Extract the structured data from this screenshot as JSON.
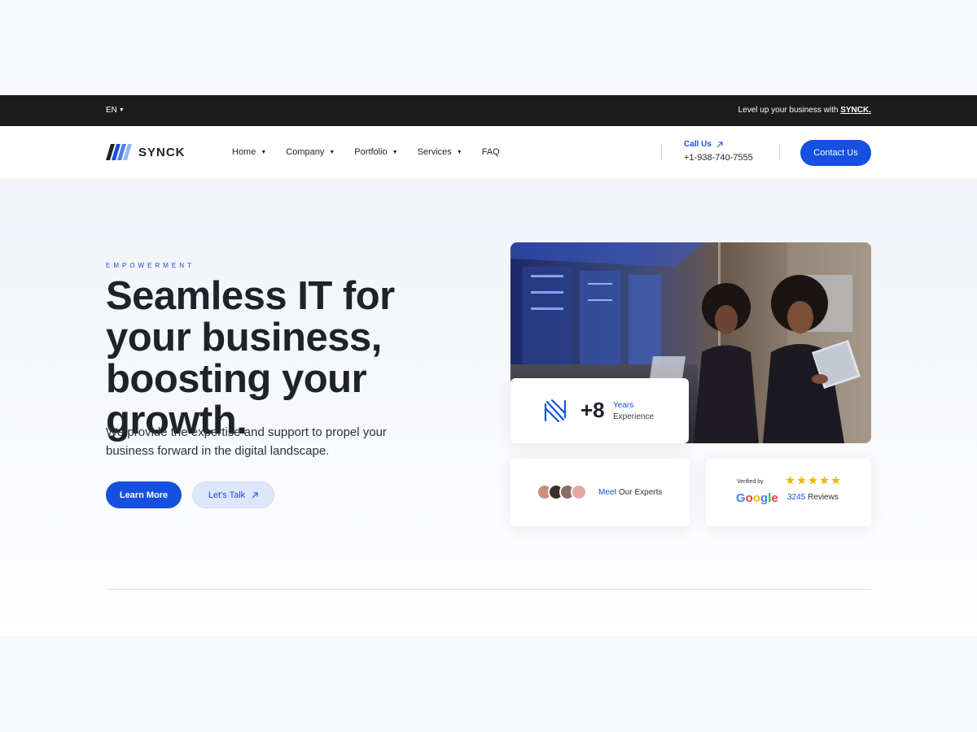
{
  "topbar": {
    "language": "EN",
    "promo_text": "Level up your business with ",
    "promo_brand": "SYNCK."
  },
  "nav": {
    "logo_text": "SYNCK",
    "items": [
      {
        "label": "Home",
        "has_dropdown": true
      },
      {
        "label": "Company",
        "has_dropdown": true
      },
      {
        "label": "Portfolio",
        "has_dropdown": true
      },
      {
        "label": "Services",
        "has_dropdown": true
      },
      {
        "label": "FAQ",
        "has_dropdown": false
      }
    ],
    "call_label": "Call Us",
    "call_number": "+1-938-740-7555",
    "contact_button": "Contact Us"
  },
  "hero": {
    "eyebrow": "EMPOWERMENT",
    "headline": "Seamless IT for your business, boosting your growth.",
    "subtext": "We provide the expertise and support to propel your business forward in the digital landscape.",
    "primary_button": "Learn More",
    "secondary_button": "Let's Talk"
  },
  "experience_card": {
    "value": "+8",
    "label_line1": "Years",
    "label_line2": "Experience"
  },
  "experts_card": {
    "highlight": "Meet",
    "label": "Our Experts"
  },
  "reviews_card": {
    "verified_label": "Verified by",
    "provider": "Google",
    "rating_stars": 5,
    "review_count": "3245",
    "review_label": "Reviews"
  },
  "colors": {
    "accent": "#1650e0",
    "topbar_bg": "#1c1c1c",
    "star": "#f5b400"
  },
  "icons": [
    "caret-down-icon",
    "arrow-up-right-icon",
    "star-icon"
  ]
}
